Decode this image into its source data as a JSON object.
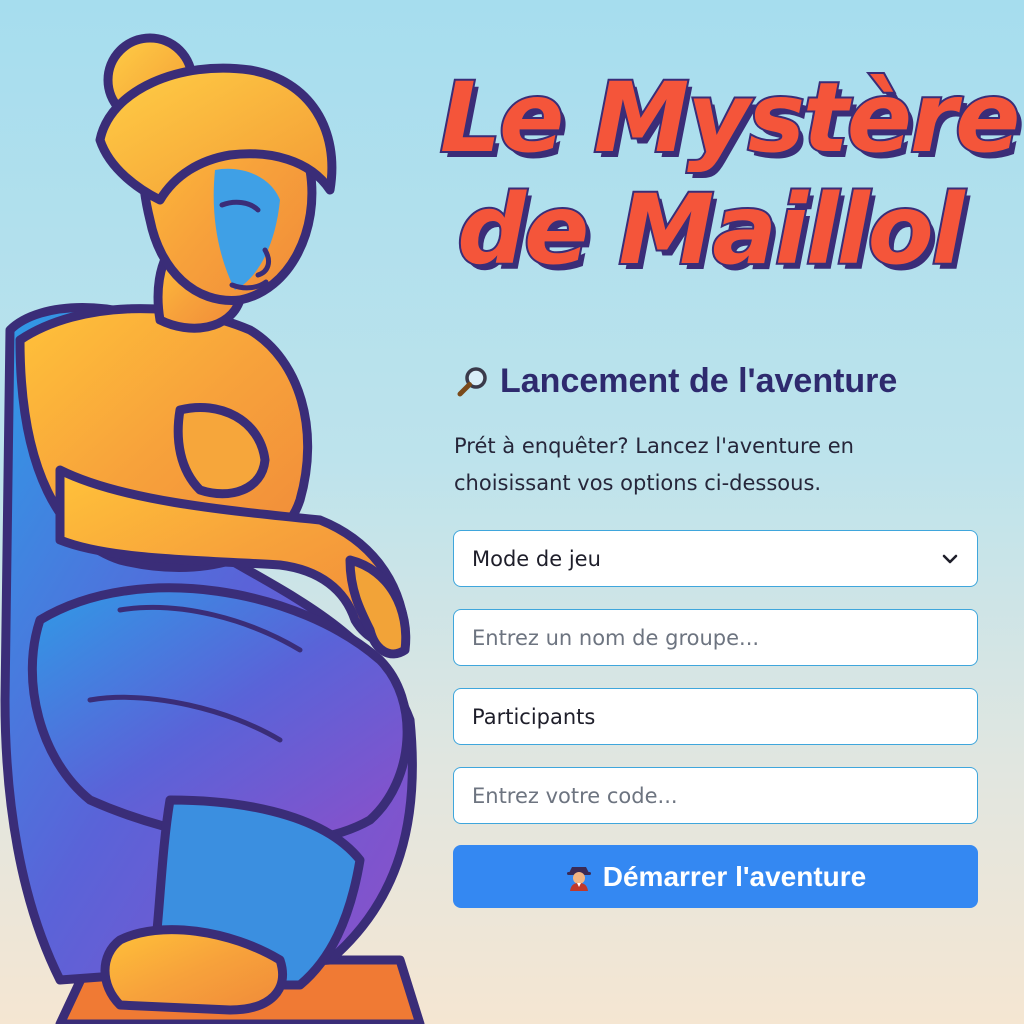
{
  "title": {
    "line1": "Le Mystère",
    "line2": "de Maillol"
  },
  "section": {
    "icon": "magnifier-icon",
    "heading": "Lancement de l'aventure",
    "intro": "Prét à enquêter? Lancez l'aventure en choisissant vos options ci-dessous."
  },
  "form": {
    "mode_select": {
      "value": "Mode de jeu",
      "icon": "chevron-down-icon"
    },
    "group_name": {
      "placeholder": "Entrez un nom de groupe..."
    },
    "participants": {
      "value": "Participants"
    },
    "code": {
      "placeholder": "Entrez votre code..."
    },
    "start_button": {
      "label": "Démarrer l'aventure",
      "icon": "detective-icon"
    }
  },
  "colors": {
    "title_fill": "#f4553a",
    "title_outline": "#3a2d78",
    "heading": "#2e2a6e",
    "field_border": "#3fa6dc",
    "button": "#3488f2",
    "background_top": "#a6ddee",
    "background_bottom": "#f5e6d2"
  },
  "illustration": {
    "subject": "seated-statue-illustration"
  }
}
